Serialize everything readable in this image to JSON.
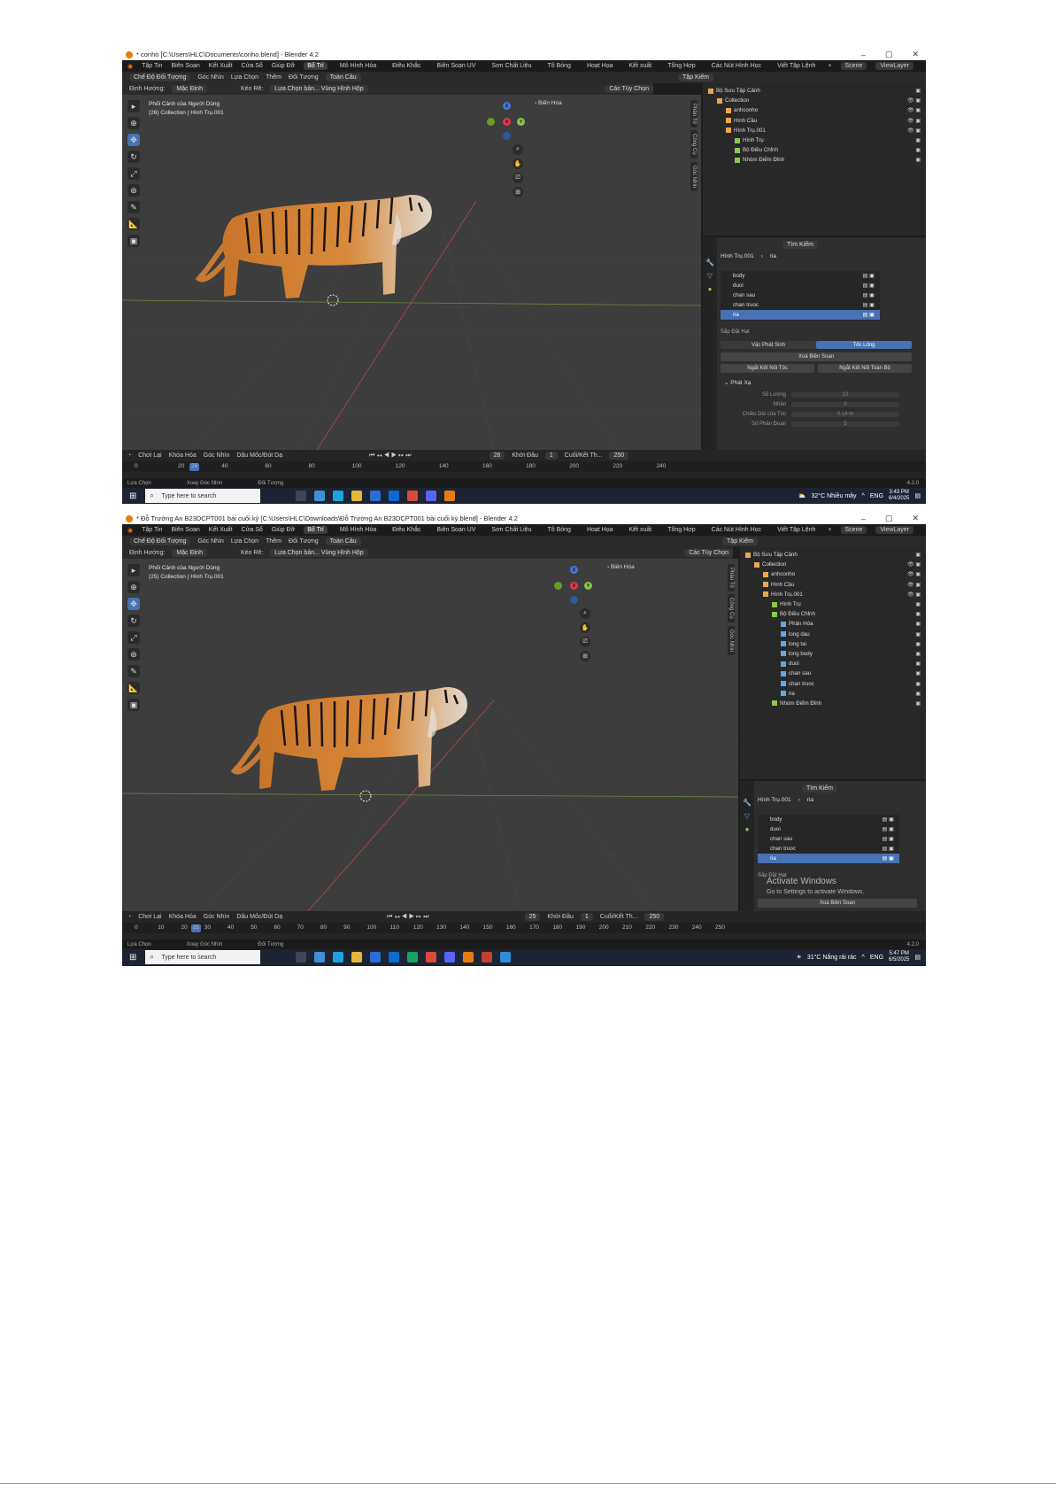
{
  "colors": {
    "accent": "#4772b3",
    "bg": "#1d1d1d",
    "viewport": "#3d3d3d",
    "orange": "#e87d0d"
  },
  "s1": {
    "title": "* conho [C:\\Users\\HLC\\Documents\\conho.blend] - Blender 4.2",
    "menu": [
      "Tập Tin",
      "Biên Soạn",
      "Kết Xuất",
      "Cửa Sổ",
      "Giúp Đỡ"
    ],
    "workspaces": [
      "Bố Trí",
      "Mô Hình Hóa",
      "Điêu Khắc",
      "Biên Soạn UV",
      "Sơn Chất Liệu",
      "Tô Bóng",
      "Hoạt Họa",
      "Kết xuất",
      "Tổng Hợp",
      "Các Nút Hình Học",
      "Viết Tập Lệnh"
    ],
    "scene": "Scene",
    "viewlayer": "ViewLayer",
    "header_mode": "Chế Độ Đối Tượng",
    "header_items": [
      "Góc Nhìn",
      "Lựa Chọn",
      "Thêm",
      "Đối Tượng"
    ],
    "global": "Toàn Cầu",
    "orient_label": "Định Hướng:",
    "orient_value": "Mặc Định",
    "drag_label": "Kéo Rê:",
    "drag_value": "Lựa Chọn bản... Vùng Hình Hộp",
    "options": "Các Tùy Chọn",
    "vp_line1": "Phối Cảnh của Người Dùng",
    "vp_line2": "(26) Collection | Hình Trụ.001",
    "bien_hoa": "Biến Hóa",
    "ntabs": [
      "Phần Tử",
      "Công Cụ",
      "Góc Nhìn"
    ],
    "outliner_search": "Tập Kiểm",
    "outliner_rows": [
      {
        "label": "Bộ Sưu Tập Cảnh",
        "indent": 0
      },
      {
        "label": "Collection",
        "indent": 1
      },
      {
        "label": "anhconho",
        "indent": 2
      },
      {
        "label": "Hình Cầu",
        "indent": 2
      },
      {
        "label": "Hình Trụ.001",
        "indent": 2
      },
      {
        "label": "Hình Trụ",
        "indent": 3
      },
      {
        "label": "Bộ Điều Chỉnh",
        "indent": 3
      },
      {
        "label": "Nhóm Điểm Đỉnh",
        "indent": 3
      }
    ],
    "props_search": "Tìm Kiếm",
    "props_path": [
      "Hình Trụ.001",
      "ria"
    ],
    "vgroups": [
      "body",
      "duoi",
      "chan sau",
      "chan truoc",
      "ria"
    ],
    "vg_selected": 4,
    "tab_a": "Vặc Phát Sinh",
    "tab_b": "Tốc Lông",
    "sap_dat_hat": "Sắp Đặt Hạt",
    "btn_delete": "Xoá Biên Soạn",
    "btn_sep1": "Ngắt Kết Nối Tóc",
    "btn_sep2": "Ngắt Kết Nối Toàn Bộ",
    "emission": "Phát Xạ",
    "em_rows": [
      {
        "k": "Số Lượng",
        "v": "12"
      },
      {
        "k": "Nhân",
        "v": "0"
      },
      {
        "k": "Chiều Dài của Tóc",
        "v": "0.14 m"
      },
      {
        "k": "Số Phân Đoạn",
        "v": "5"
      }
    ],
    "tl_items": [
      "Chơi Lại",
      "Khóa Hóa",
      "Góc Nhìn",
      "Dấu Mốc/Đút Dạ"
    ],
    "tl_frame": "26",
    "tl_start_label": "Khởi Đầu",
    "tl_start": "1",
    "tl_end_label": "Cuối/Kết Th...",
    "tl_end": "250",
    "ruler": [
      "0",
      "20",
      "40",
      "60",
      "80",
      "100",
      "120",
      "140",
      "160",
      "180",
      "200",
      "220",
      "240"
    ],
    "ruler_cur": "26",
    "status": [
      "Lựa Chọn",
      "Xoay Góc Nhìn",
      "Đối Tượng"
    ],
    "version": "4.2.0",
    "taskbar_search": "Type here to search",
    "weather": "32°C  Nhiều mây",
    "lang": "ENG",
    "time": "3:43 PM",
    "date": "6/4/2025"
  },
  "s2": {
    "title": "* Đỗ Trường An B23DCPT001 bài cuối kỳ [C:\\Users\\HLC\\Downloads\\Đỗ Trường An B23DCPT001 bài cuối kỳ.blend] - Blender 4.2",
    "vp_line1": "Phối Cảnh của Người Dùng",
    "vp_line2": "(25) Collection | Hình Trụ.001",
    "outliner_rows": [
      {
        "label": "Bộ Sưu Tập Cảnh",
        "indent": 0
      },
      {
        "label": "Collection",
        "indent": 1
      },
      {
        "label": "anhconho",
        "indent": 2
      },
      {
        "label": "Hình Cầu",
        "indent": 2
      },
      {
        "label": "Hình Trụ.001",
        "indent": 2
      },
      {
        "label": "Hình Trụ",
        "indent": 3
      },
      {
        "label": "Bộ Điều Chỉnh",
        "indent": 3
      },
      {
        "label": "Phân Hóa",
        "indent": 4
      },
      {
        "label": "long dau",
        "indent": 4
      },
      {
        "label": "long tai",
        "indent": 4
      },
      {
        "label": "long body",
        "indent": 4
      },
      {
        "label": "duoi",
        "indent": 4
      },
      {
        "label": "chan sau",
        "indent": 4
      },
      {
        "label": "chan truoc",
        "indent": 4
      },
      {
        "label": "ria",
        "indent": 4
      },
      {
        "label": "Nhóm Điểm Đỉnh",
        "indent": 3
      }
    ],
    "props_path": [
      "Hình Trụ.001",
      "ria"
    ],
    "vgroups": [
      "body",
      "duoi",
      "chan sau",
      "chan truoc",
      "ria"
    ],
    "vg_selected": 4,
    "sap_dat_hat": "Sắp Đặt Hạt",
    "activate1": "Activate Windows",
    "activate2": "Go to Settings to activate Windows.",
    "btn_delete": "Xoá Biên Soạn",
    "tl_frame": "25",
    "tl_start": "1",
    "tl_end": "250",
    "ruler": [
      "0",
      "10",
      "20",
      "30",
      "40",
      "50",
      "60",
      "70",
      "80",
      "90",
      "100",
      "110",
      "120",
      "130",
      "140",
      "150",
      "160",
      "170",
      "180",
      "190",
      "200",
      "210",
      "220",
      "230",
      "240",
      "250"
    ],
    "ruler_cur": "25",
    "weather": "31°C  Nắng rải rác",
    "lang": "ENG",
    "time": "5:47 PM",
    "date": "6/5/2025"
  }
}
